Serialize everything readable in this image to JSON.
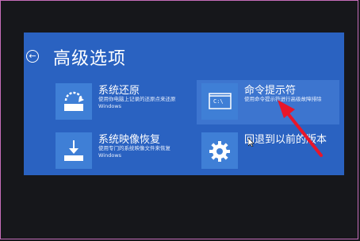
{
  "page": {
    "title": "高级选项",
    "back_glyph": "←"
  },
  "tiles": [
    {
      "title": "系统还原",
      "desc": "使用你电脑上记录的还原点来还原 Windows",
      "icon": "system-restore-icon"
    },
    {
      "title": "命令提示符",
      "desc": "使用命令提示符进行高级故障排除",
      "icon": "command-prompt-icon",
      "icon_text": "C:\\"
    },
    {
      "title": "系统映像恢复",
      "desc": "使用专门的系统映像文件来恢复 Windows",
      "icon": "system-image-recovery-icon"
    },
    {
      "title": "回退到以前的版本",
      "desc": "",
      "icon": "gear-icon"
    }
  ],
  "colors": {
    "screen_bg": "#2a62c1",
    "tile_icon_bg": "#3f7fd6",
    "highlight_bg": "#3d75cf",
    "annotation_arrow": "#e8162a",
    "frame": "#c56db9"
  }
}
